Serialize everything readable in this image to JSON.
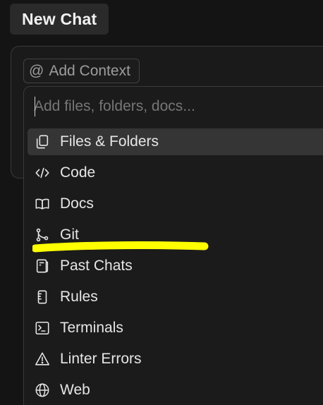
{
  "header": {
    "tab_label": "New Chat"
  },
  "composer": {
    "add_context_label": "Add Context",
    "at_symbol": "@"
  },
  "context_menu": {
    "search_placeholder": "Add files, folders, docs...",
    "items": [
      {
        "label": "Files & Folders",
        "icon": "files-icon",
        "selected": true
      },
      {
        "label": "Code",
        "icon": "code-icon",
        "selected": false
      },
      {
        "label": "Docs",
        "icon": "book-icon",
        "selected": false
      },
      {
        "label": "Git",
        "icon": "git-branch-icon",
        "selected": false
      },
      {
        "label": "Past Chats",
        "icon": "past-chats-icon",
        "selected": false
      },
      {
        "label": "Rules",
        "icon": "rules-icon",
        "selected": false
      },
      {
        "label": "Terminals",
        "icon": "terminal-icon",
        "selected": false
      },
      {
        "label": "Linter Errors",
        "icon": "warning-icon",
        "selected": false
      },
      {
        "label": "Web",
        "icon": "globe-icon",
        "selected": false
      }
    ]
  },
  "annotation": {
    "highlight_color": "#ffff00"
  },
  "colors": {
    "background": "#141414",
    "panel": "#1b1b1b",
    "selected_row": "#353535",
    "text": "#e6e6e6",
    "muted_text": "#9d9d9d"
  }
}
